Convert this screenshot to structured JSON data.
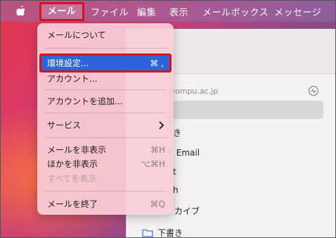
{
  "menubar": {
    "apple_icon": "apple-icon",
    "items": [
      "メール",
      "ファイル",
      "編集",
      "表示",
      "メールボックス",
      "メッセージ"
    ]
  },
  "mail_menu": {
    "about": "メールについて",
    "preferences": {
      "label": "環境設定...",
      "shortcut": "⌘ ,"
    },
    "accounts": "アカウント...",
    "add_account": "アカウントを追加...",
    "services": "サービス",
    "hide_mail": {
      "label": "メールを非表示",
      "shortcut": "⌘H"
    },
    "hide_others": {
      "label": "ほかを非表示",
      "shortcut": "⌥⌘H"
    },
    "show_all": "すべてを表示",
    "quit": {
      "label": "メールを終了",
      "shortcut": "⌘Q"
    }
  },
  "window": {
    "account_email": "@ompu.ac.jp",
    "sidebar_fragments": [
      "き",
      "k Email",
      "t",
      "h",
      "カイブ"
    ],
    "drafts": "下書き"
  },
  "colors": {
    "highlight_border": "#d8121f",
    "selection": "#2e64d8"
  }
}
